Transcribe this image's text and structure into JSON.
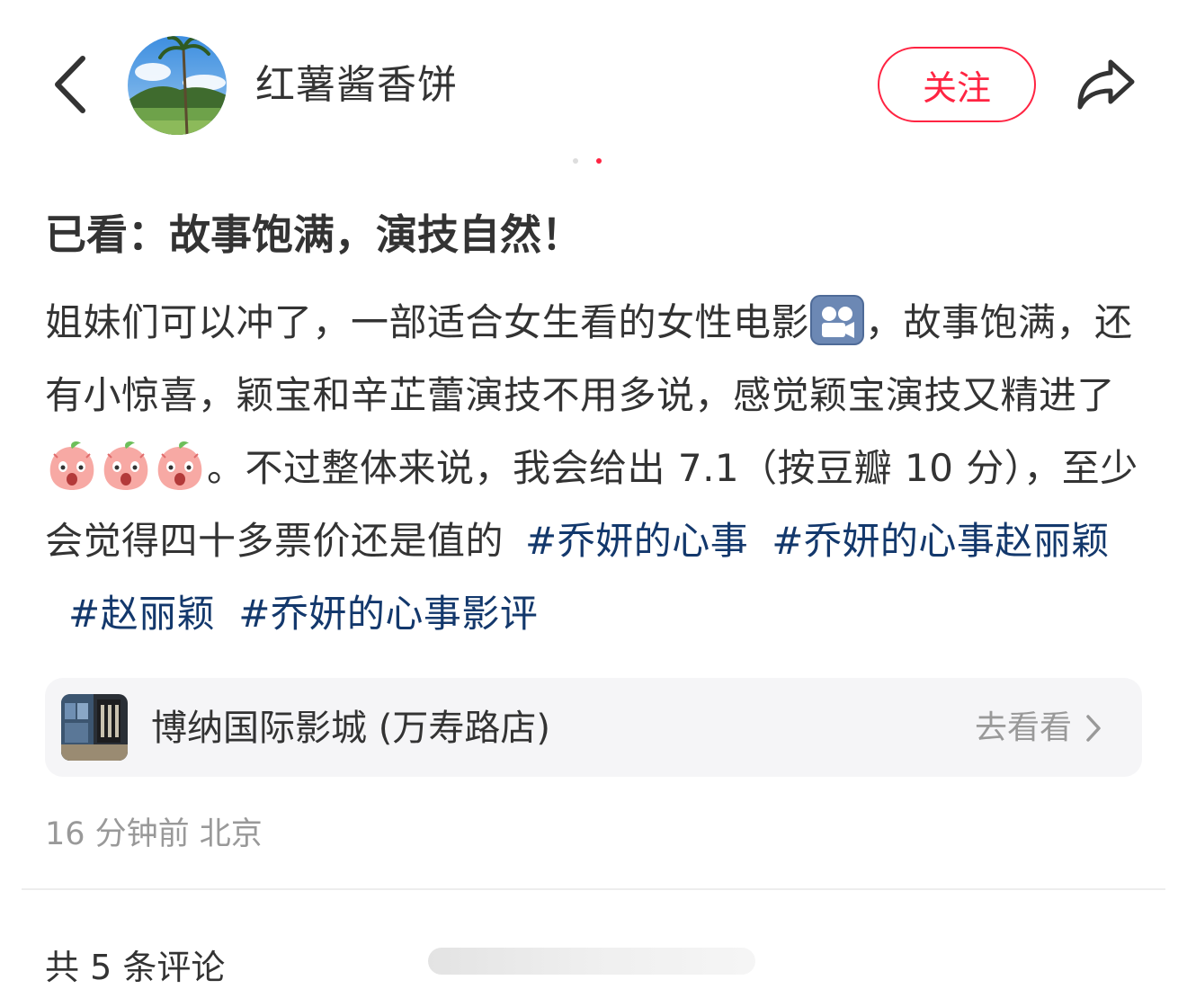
{
  "header": {
    "username": "红薯酱香饼",
    "follow_label": "关注"
  },
  "post": {
    "title": "已看：故事饱满，演技自然！",
    "body": {
      "part1": "姐妹们可以冲了，一部适合女生看的女性电影",
      "part2": "，故事饱满，还有小惊喜，颖宝和辛芷蕾演技不用多说，感觉颖宝演技又精进了",
      "part3": "。不过整体来说，我会给出 7.1（按豆瓣 10 分），至少会觉得四十多票价还是值的"
    },
    "tags": [
      "#乔妍的心事",
      "#乔妍的心事赵丽颖",
      "#赵丽颖",
      "#乔妍的心事影评"
    ],
    "emoji": {
      "film": "movie-camera-icon",
      "reaction": "shocked-peach-icon",
      "reaction_count": 3
    }
  },
  "location": {
    "name": "博纳国际影城 (万寿路店)",
    "action_label": "去看看"
  },
  "meta": {
    "timestamp": "16 分钟前 北京"
  },
  "comments": {
    "count_label": "共 5 条评论"
  },
  "colors": {
    "accent": "#ff2442",
    "tag": "#13386c",
    "muted": "#999999",
    "card_bg": "#f5f5f7"
  }
}
